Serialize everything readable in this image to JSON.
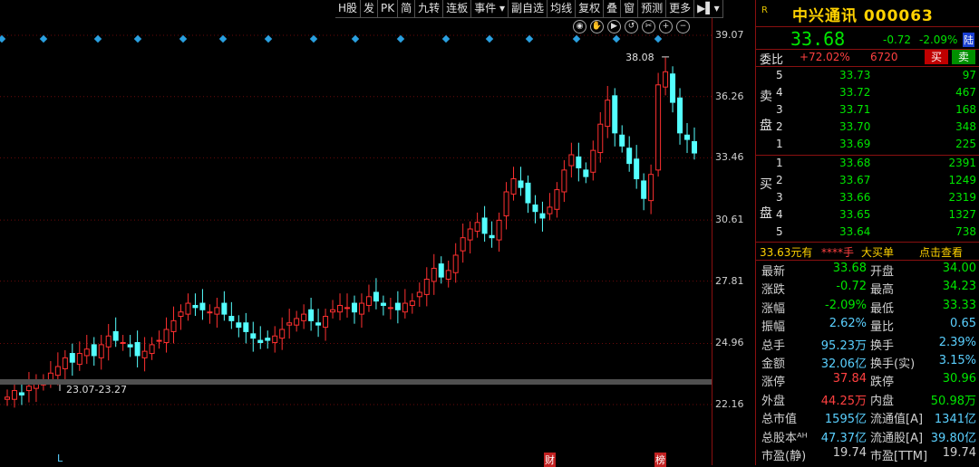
{
  "toolbar": [
    "H股",
    "发",
    "PK",
    "简",
    "九转",
    "连板",
    "事件 ▾",
    "副自选",
    "均线",
    "复权",
    "叠",
    "窗",
    "预测",
    "更多",
    "▶▌▾"
  ],
  "chart": {
    "y_labels": [
      "39.07",
      "36.26",
      "33.46",
      "30.61",
      "27.81",
      "24.96",
      "22.16"
    ],
    "peak_label": "38.08",
    "range_label": "23.07-23.27",
    "bottom_marks": [
      "L",
      "财",
      "榜"
    ]
  },
  "chart_data": {
    "type": "candlestick",
    "ylim": [
      22.16,
      39.07
    ],
    "y_ticks": [
      39.07,
      36.26,
      33.46,
      30.61,
      27.81,
      24.96,
      22.16
    ],
    "closes": [
      22.5,
      22.8,
      22.6,
      23.0,
      23.2,
      23.1,
      23.6,
      23.9,
      24.3,
      24.1,
      24.5,
      24.7,
      24.4,
      24.9,
      25.3,
      25.1,
      25.0,
      24.8,
      24.4,
      24.6,
      24.9,
      25.1,
      25.6,
      26.0,
      26.4,
      26.8,
      26.6,
      26.5,
      26.4,
      26.6,
      26.3,
      26.0,
      25.7,
      25.5,
      25.2,
      25.0,
      25.1,
      25.3,
      25.6,
      25.9,
      26.1,
      26.3,
      26.0,
      25.8,
      26.2,
      26.5,
      26.7,
      26.6,
      26.4,
      26.8,
      27.1,
      26.9,
      26.7,
      26.6,
      26.5,
      26.8,
      26.9,
      27.3,
      27.9,
      28.4,
      28.0,
      28.3,
      29.0,
      29.8,
      30.2,
      30.5,
      30.0,
      29.8,
      30.6,
      31.9,
      32.5,
      32.1,
      31.4,
      31.0,
      30.7,
      31.2,
      32.0,
      32.9,
      33.6,
      33.0,
      32.6,
      33.8,
      35.0,
      36.1,
      34.6,
      34.0,
      33.2,
      32.5,
      31.6,
      32.7,
      36.8,
      37.4,
      36.0,
      34.6,
      34.3,
      33.68
    ],
    "range_label": "23.07-23.27",
    "max_label": 38.08
  },
  "panel": {
    "badge": "R",
    "title": "中兴通讯 000063",
    "price": "33.68",
    "change": "-0.72",
    "change_pct": "-2.09%",
    "market": "陆",
    "wb_label": "委比",
    "wb_pct": "+72.02%",
    "wb_vol": "6720",
    "sell_btn": "买",
    "buy_btn": "卖",
    "sell_side": "卖盘",
    "buy_side": "买盘",
    "asks": [
      {
        "lvl": "5",
        "px": "33.73",
        "vol": "97"
      },
      {
        "lvl": "4",
        "px": "33.72",
        "vol": "467"
      },
      {
        "lvl": "3",
        "px": "33.71",
        "vol": "168"
      },
      {
        "lvl": "2",
        "px": "33.70",
        "vol": "348"
      },
      {
        "lvl": "1",
        "px": "33.69",
        "vol": "225"
      }
    ],
    "bids": [
      {
        "lvl": "1",
        "px": "33.68",
        "vol": "2391"
      },
      {
        "lvl": "2",
        "px": "33.67",
        "vol": "1249"
      },
      {
        "lvl": "3",
        "px": "33.66",
        "vol": "2319"
      },
      {
        "lvl": "4",
        "px": "33.65",
        "vol": "1327"
      },
      {
        "lvl": "5",
        "px": "33.64",
        "vol": "738"
      }
    ],
    "big_order": {
      "a": "33.63元有",
      "b": "****手",
      "c": "大买单",
      "d": "点击查看"
    },
    "stats": [
      {
        "l1": "最新",
        "v1": "33.68",
        "c1": "#00e600",
        "l2": "开盘",
        "v2": "34.00",
        "c2": "#00e600"
      },
      {
        "l1": "涨跌",
        "v1": "-0.72",
        "c1": "#00e600",
        "l2": "最高",
        "v2": "34.23",
        "c2": "#00e600"
      },
      {
        "l1": "涨幅",
        "v1": "-2.09%",
        "c1": "#00e600",
        "l2": "最低",
        "v2": "33.33",
        "c2": "#00e600"
      },
      {
        "l1": "振幅",
        "v1": "2.62%",
        "c1": "#5ad0ff",
        "l2": "量比",
        "v2": "0.65",
        "c2": "#5ad0ff"
      },
      {
        "l1": "总手",
        "v1": "95.23万",
        "c1": "#5ad0ff",
        "l2": "换手",
        "v2": "2.39%",
        "c2": "#5ad0ff"
      },
      {
        "l1": "金额",
        "v1": "32.06亿",
        "c1": "#5ad0ff",
        "l2": "换手(实)",
        "v2": "3.15%",
        "c2": "#5ad0ff"
      },
      {
        "l1": "涨停",
        "v1": "37.84",
        "c1": "#ff4040",
        "l2": "跌停",
        "v2": "30.96",
        "c2": "#00e600"
      },
      {
        "l1": "外盘",
        "v1": "44.25万",
        "c1": "#ff4040",
        "l2": "内盘",
        "v2": "50.98万",
        "c2": "#00e600"
      },
      {
        "l1": "总市值",
        "v1": "1595亿",
        "c1": "#5ad0ff",
        "l2": "流通值[A]",
        "v2": "1341亿",
        "c2": "#5ad0ff"
      },
      {
        "l1": "总股本ᴬᴴ",
        "v1": "47.37亿",
        "c1": "#5ad0ff",
        "l2": "流通股[A]",
        "v2": "39.80亿",
        "c2": "#5ad0ff"
      },
      {
        "l1": "市盈(静)",
        "v1": "19.74",
        "c1": "#d0d0d0",
        "l2": "市盈[TTM]",
        "v2": "19.74",
        "c2": "#d0d0d0"
      }
    ]
  }
}
